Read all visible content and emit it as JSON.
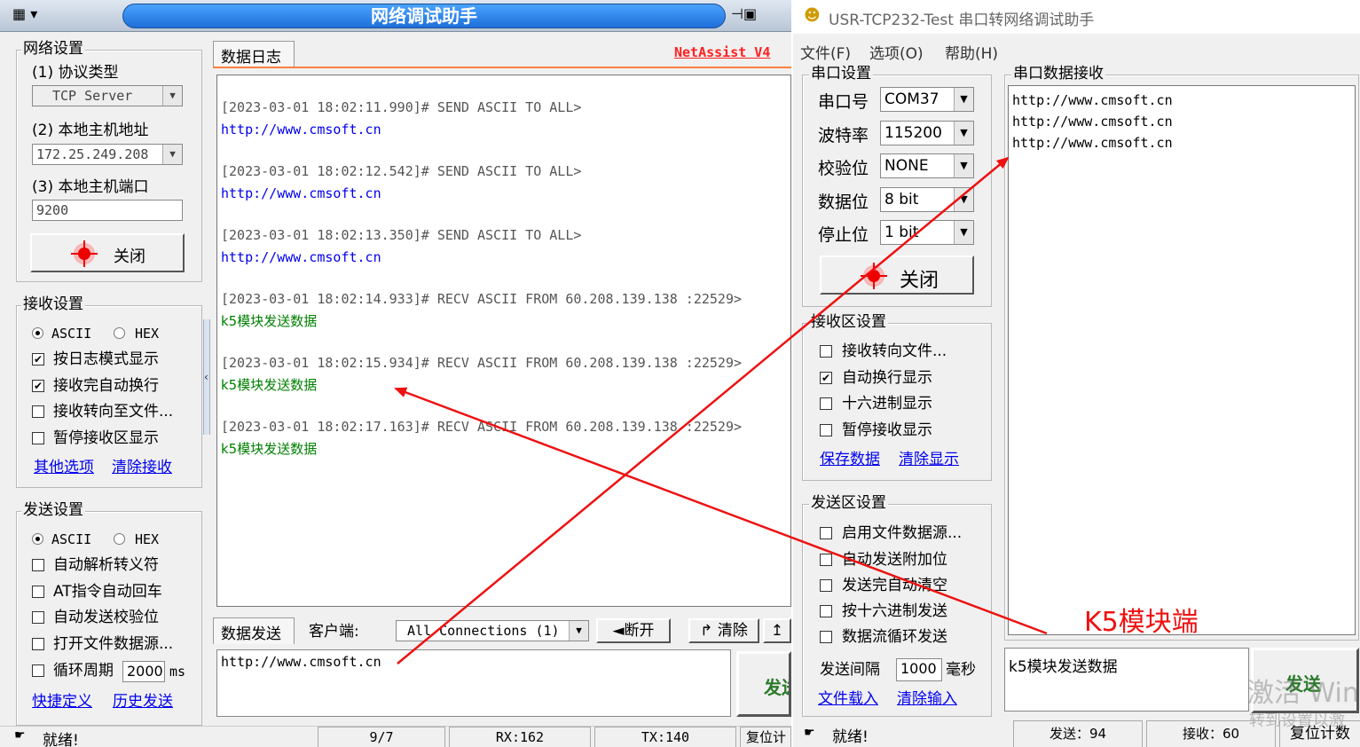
{
  "left_app": {
    "title": "网络调试助手",
    "net_settings": {
      "group": "网络设置",
      "protocol_label": "(1) 协议类型",
      "protocol_value": "TCP Server",
      "host_label": "(2) 本地主机地址",
      "host_value": "172.25.249.208",
      "port_label": "(3) 本地主机端口",
      "port_value": "9200",
      "close_btn": "关闭"
    },
    "recv_settings": {
      "group": "接收设置",
      "ascii": "ASCII",
      "hex": "HEX",
      "log_mode": "按日志模式显示",
      "auto_wrap": "接收完自动换行",
      "to_file": "接收转向至文件...",
      "pause": "暂停接收区显示",
      "more_link": "其他选项",
      "clear_link": "清除接收"
    },
    "send_settings": {
      "group": "发送设置",
      "ascii": "ASCII",
      "hex": "HEX",
      "escape": "自动解析转义符",
      "at_cr": "AT指令自动回车",
      "checksum": "自动发送校验位",
      "file_src": "打开文件数据源...",
      "cycle": "循环周期",
      "cycle_value": "2000",
      "cycle_unit": "ms",
      "quick_link": "快捷定义",
      "history_link": "历史发送"
    },
    "log_tab": "数据日志",
    "brand": "NetAssist V4",
    "log": [
      {
        "header": "[2023-03-01 18:02:11.990]# SEND ASCII TO ALL>",
        "body": "http://www.cmsoft.cn",
        "kind": "send"
      },
      {
        "header": "[2023-03-01 18:02:12.542]# SEND ASCII TO ALL>",
        "body": "http://www.cmsoft.cn",
        "kind": "send"
      },
      {
        "header": "[2023-03-01 18:02:13.350]# SEND ASCII TO ALL>",
        "body": "http://www.cmsoft.cn",
        "kind": "send"
      },
      {
        "header": "[2023-03-01 18:02:14.933]# RECV ASCII FROM 60.208.139.138 :22529>",
        "body": "k5模块发送数据",
        "kind": "recv"
      },
      {
        "header": "[2023-03-01 18:02:15.934]# RECV ASCII FROM 60.208.139.138 :22529>",
        "body": "k5模块发送数据",
        "kind": "recv"
      },
      {
        "header": "[2023-03-01 18:02:17.163]# RECV ASCII FROM 60.208.139.138 :22529>",
        "body": "k5模块发送数据",
        "kind": "recv"
      }
    ],
    "send_tab": "数据发送",
    "client_label": "客户端:",
    "client_value": "All Connections (1)",
    "disconnect_btn": "断开",
    "clear_btn": "清除",
    "send_text": "http://www.cmsoft.cn",
    "send_btn": "发送",
    "status": {
      "ready": "就绪!",
      "count": "9/7",
      "rx": "RX:162",
      "tx": "TX:140",
      "reset": "复位计数"
    }
  },
  "right_app": {
    "title": "USR-TCP232-Test 串口转网络调试助手",
    "menu": [
      "文件(F)",
      "选项(O)",
      "帮助(H)"
    ],
    "serial": {
      "group": "串口设置",
      "fields": [
        {
          "label": "串口号",
          "value": "COM37"
        },
        {
          "label": "波特率",
          "value": "115200"
        },
        {
          "label": "校验位",
          "value": "NONE"
        },
        {
          "label": "数据位",
          "value": "8 bit"
        },
        {
          "label": "停止位",
          "value": "1 bit"
        }
      ],
      "close_btn": "关闭"
    },
    "recv_area": {
      "group": "接收区设置",
      "to_file": "接收转向文件...",
      "auto_wrap": "自动换行显示",
      "hex_show": "十六进制显示",
      "pause": "暂停接收显示",
      "save_link": "保存数据",
      "clear_link": "清除显示"
    },
    "send_area": {
      "group": "发送区设置",
      "file_src": "启用文件数据源...",
      "append": "自动发送附加位",
      "auto_clear": "发送完自动清空",
      "hex_send": "按十六进制发送",
      "loop": "数据流循环发送",
      "interval_label": "发送间隔",
      "interval_value": "1000",
      "interval_unit": "毫秒",
      "load_link": "文件载入",
      "clear_link": "清除输入"
    },
    "serial_recv_group": "串口数据接收",
    "recv_lines": [
      "http://www.cmsoft.cn",
      "http://www.cmsoft.cn",
      "http://www.cmsoft.cn"
    ],
    "send_text": "k5模块发送数据",
    "send_btn": "发送",
    "status": {
      "ready": "就绪!",
      "sent": "发送：94",
      "recv": "接收：60",
      "reset": "复位计数"
    },
    "watermark": "激活 Win",
    "watermark_sub": "转到设置以激"
  },
  "annotation": {
    "label": "K5模块端",
    "color": "#ee1111"
  },
  "colors": {
    "send_link": "#0000ee",
    "recv_green": "#008000",
    "title_bar": "#1e90ff",
    "brand_red": "#ff2020"
  }
}
